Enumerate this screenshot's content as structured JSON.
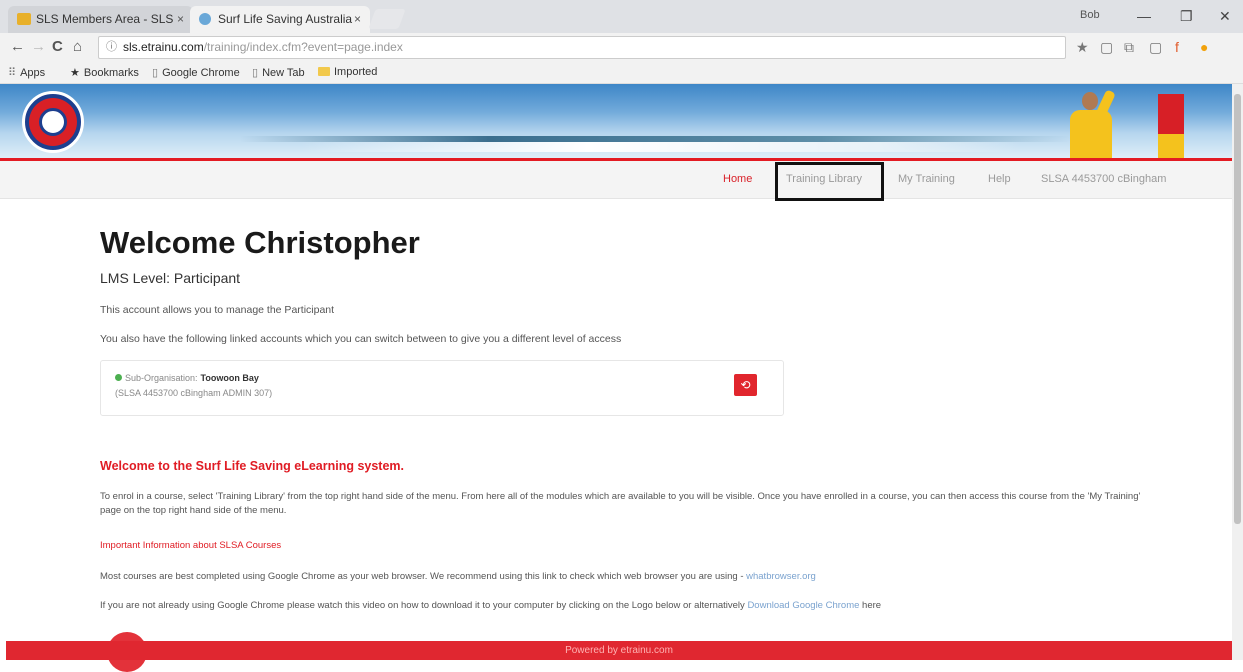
{
  "browser": {
    "tabs": [
      {
        "title": "SLS Members Area - SLS",
        "favicon_color": "#e8b02a"
      },
      {
        "title": "Surf Life Saving Australia",
        "favicon_color": "#6aa8d8"
      }
    ],
    "tab_close": "×",
    "user": "Bob",
    "window_controls": {
      "minimize": "—",
      "maximize": "❐",
      "close": "✕"
    },
    "url_host": "sls.etrainu.com",
    "url_path": "/training/index.cfm?event=page.index",
    "nav_icons": {
      "back": "←",
      "forward": "→",
      "reload": "C",
      "home": "⌂",
      "info": "ⓘ"
    },
    "toolbar_icons": [
      "★",
      "▢",
      "⧉",
      "▢",
      "f",
      "●"
    ],
    "bookmarks": [
      {
        "label": "Apps",
        "icon": "apps-grid-icon"
      },
      {
        "label": "Bookmarks",
        "icon": "star-icon"
      },
      {
        "label": "Google Chrome",
        "icon": "page-icon"
      },
      {
        "label": "New Tab",
        "icon": "page-icon"
      },
      {
        "label": "Imported",
        "icon": "folder-icon"
      }
    ]
  },
  "site": {
    "nav": [
      {
        "label": "Home",
        "active": true
      },
      {
        "label": "Training Library",
        "active": false
      },
      {
        "label": "My Training",
        "active": false
      },
      {
        "label": "Help",
        "active": false
      },
      {
        "label": "SLSA 4453700 cBingham",
        "active": false
      }
    ]
  },
  "main": {
    "welcome": "Welcome Christopher",
    "lms_level": "LMS Level: Participant",
    "account_text": "This account allows you to manage the Participant",
    "linked_text": "You also have the following linked accounts which you can switch between to give you a different level of access",
    "account": {
      "type": "Sub-Organisation:",
      "org": "Toowoon Bay",
      "detail": "(SLSA 4453700 cBingham ADMIN 307)",
      "switch_icon": "⟲"
    },
    "elearning_heading": "Welcome to the Surf Life Saving eLearning system.",
    "enrol_text": "To enrol in a course, select 'Training Library' from the top right hand side of the menu. From here all of the modules which are available to you will be visible. Once you have enrolled in a course, you can then access this course from the 'My Training' page on the top right hand side of the menu.",
    "important_link": "Important Information about SLSA Courses",
    "browser_text": "Most courses are best completed using Google Chrome as your web browser. We recommend using this link to check which web browser you are using - ",
    "browser_link": "whatbrowser.org",
    "chrome_text": "If you are not already using Google Chrome please watch this video on how to download it to your computer by clicking on the Logo below or alternatively ",
    "chrome_link": "Download Google Chrome",
    "chrome_text_end": " here"
  },
  "footer": {
    "text": "Powered by etrainu.com"
  },
  "colors": {
    "brand_red": "#e01c24",
    "nav_grey": "#9a9a9a",
    "link_blue": "#7ba3cf"
  }
}
